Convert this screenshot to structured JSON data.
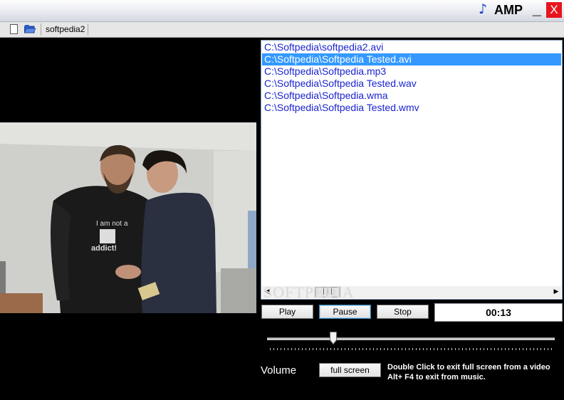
{
  "window": {
    "title": "AMP",
    "minimize_label": "_",
    "close_label": "X"
  },
  "toolbar": {
    "tab_label": "softpedia2"
  },
  "playlist": {
    "items": [
      "C:\\Softpedia\\softpedia2.avi",
      "C:\\Softpedia\\Softpedia Tested.avi",
      "C:\\Softpedia\\Softpedia.mp3",
      "C:\\Softpedia\\Softpedia Tested.wav",
      "C:\\Softpedia\\Softpedia.wma",
      "C:\\Softpedia\\Softpedia Tested.wmv"
    ],
    "selected_index": 1
  },
  "watermark": "SOFTPEDIA",
  "controls": {
    "play_label": "Play",
    "pause_label": "Pause",
    "stop_label": "Stop",
    "time": "00:13",
    "seek_fraction": 0.23,
    "volume_label": "Volume",
    "fullscreen_label": "full screen"
  },
  "info": {
    "line1": "Double Click to exit full screen from a video",
    "line2": "Alt+ F4 to exit from music."
  },
  "colors": {
    "background": "#000000",
    "selection": "#3399ff",
    "playlist_text": "#1a24d0",
    "close_button": "#e8141c"
  },
  "icons": [
    "music-note-icon",
    "new-file-icon",
    "open-folder-icon",
    "scroll-left-icon",
    "scroll-right-icon"
  ]
}
